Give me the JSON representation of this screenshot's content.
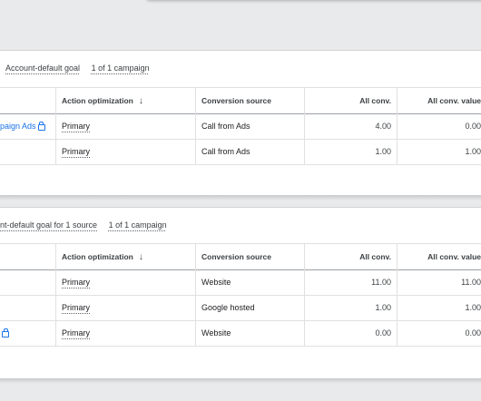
{
  "section1": {
    "goal_label": "Account-default goal",
    "campaign_count": "1 of 1 campaign",
    "columns": [
      "Action optimization",
      "Conversion source",
      "All conv.",
      "All conv. value"
    ],
    "rows": [
      {
        "name": "paign Ads",
        "has_lock": true,
        "optimization": "Primary",
        "source": "Call from Ads",
        "all_conv": "4.00",
        "all_conv_value": "0.00"
      },
      {
        "name": "",
        "has_lock": false,
        "optimization": "Primary",
        "source": "Call from Ads",
        "all_conv": "1.00",
        "all_conv_value": "1.00"
      }
    ]
  },
  "section2": {
    "goal_label": "nt-default goal for 1 source",
    "campaign_count": "1 of 1 campaign",
    "columns": [
      "Action optimization",
      "Conversion source",
      "All conv.",
      "All conv. value"
    ],
    "rows": [
      {
        "name": "",
        "has_lock": false,
        "optimization": "Primary",
        "source": "Website",
        "all_conv": "11.00",
        "all_conv_value": "11.00"
      },
      {
        "name": "",
        "has_lock": false,
        "optimization": "Primary",
        "source": "Google hosted",
        "all_conv": "1.00",
        "all_conv_value": "1.00"
      },
      {
        "name": "",
        "has_lock": true,
        "optimization": "Primary",
        "source": "Website",
        "all_conv": "0.00",
        "all_conv_value": "0.00"
      }
    ]
  },
  "sort_icon": "arrow-down-icon",
  "colors": {
    "link": "#1a73e8",
    "text": "#202124",
    "border": "#e0e0e0"
  }
}
